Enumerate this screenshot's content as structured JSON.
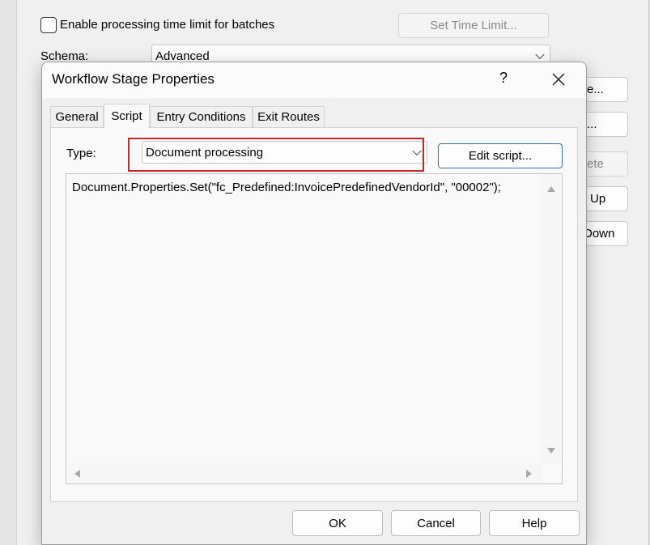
{
  "background": {
    "enable_time_limit_label": "Enable processing time limit for batches",
    "enable_time_limit_checked": false,
    "set_time_limit_button": "Set Time Limit...",
    "schema_label": "Schema:",
    "schema_value": "Advanced",
    "side_buttons": [
      "e...",
      "...",
      "ete",
      "Up",
      "Down"
    ]
  },
  "dialog": {
    "title": "Workflow Stage Properties",
    "help_symbol": "?",
    "tabs": [
      {
        "label": "General",
        "active": false
      },
      {
        "label": "Script",
        "active": true
      },
      {
        "label": "Entry Conditions",
        "active": false
      },
      {
        "label": "Exit Routes",
        "active": false
      }
    ],
    "script": {
      "type_label": "Type:",
      "type_value": "Document processing",
      "edit_button": "Edit script...",
      "code": "Document.Properties.Set(\"fc_Predefined:InvoicePredefinedVendorId\", \"00002\");"
    },
    "buttons": {
      "ok": "OK",
      "cancel": "Cancel",
      "help": "Help"
    }
  },
  "colors": {
    "highlight_box": "#c8262d",
    "edit_button_border": "#2f6fb0"
  }
}
